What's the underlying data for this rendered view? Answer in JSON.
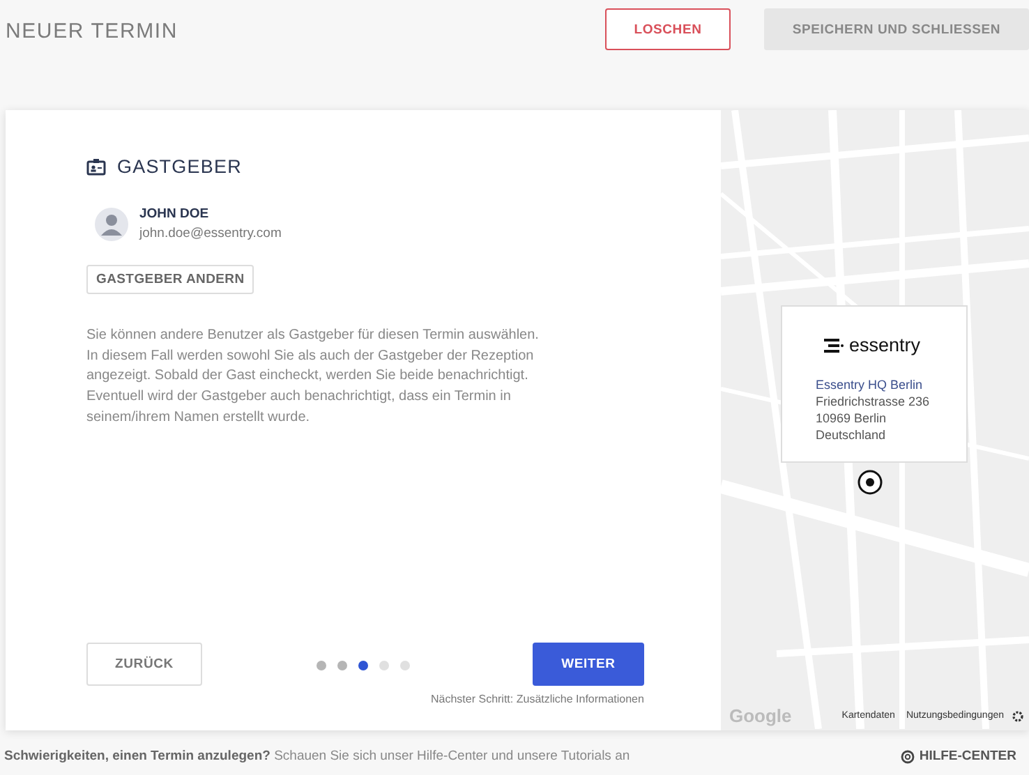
{
  "header": {
    "title": "NEUER TERMIN",
    "buttons": [
      {
        "label": "LOSCHEN",
        "kind": "danger"
      },
      {
        "label": "SPEICHERN UND SCHLIESSEN",
        "kind": "secondary"
      }
    ]
  },
  "host": {
    "heading": "GASTGEBER",
    "name": "JOHN DOE",
    "email": "john.doe@essentry.com",
    "change_button": "GASTGEBER ANDERN",
    "description": "Sie können andere Benutzer als Gastgeber für diesen Termin auswählen. In diesem Fall werden sowohl Sie als auch der Gastgeber der Rezeption angezeigt. Sobald der Gast eincheckt, werden Sie beide benachrichtigt. Eventuell wird der Gastgeber auch benachrichtigt, dass ein Termin in seinem/ihrem Namen erstellt wurde."
  },
  "navigation": {
    "back": "ZURÜCK",
    "next": "WEITER",
    "next_step": "Nächster Schritt: Zusätzliche Informationen",
    "steps": [
      {
        "selected": false,
        "done": true
      },
      {
        "selected": false,
        "done": true
      },
      {
        "selected": true,
        "done": false
      },
      {
        "selected": false,
        "done": false
      },
      {
        "selected": false,
        "done": false
      }
    ]
  },
  "map": {
    "logo": "essentry",
    "location_name": "Essentry HQ Berlin",
    "address": [
      "Friedrichstrasse 236",
      "10969 Berlin",
      "Deutschland"
    ],
    "provider": "Google",
    "links": [
      "Kartendaten",
      "Nutzungsbedingungen"
    ]
  },
  "footer": {
    "help_text": "**Schwierigkeiten, einen Termin anzulegen?** Schauen Sie sich unser Hilfe-Center und unsere Tutorials an",
    "help_link": "HILFE-CENTER"
  }
}
